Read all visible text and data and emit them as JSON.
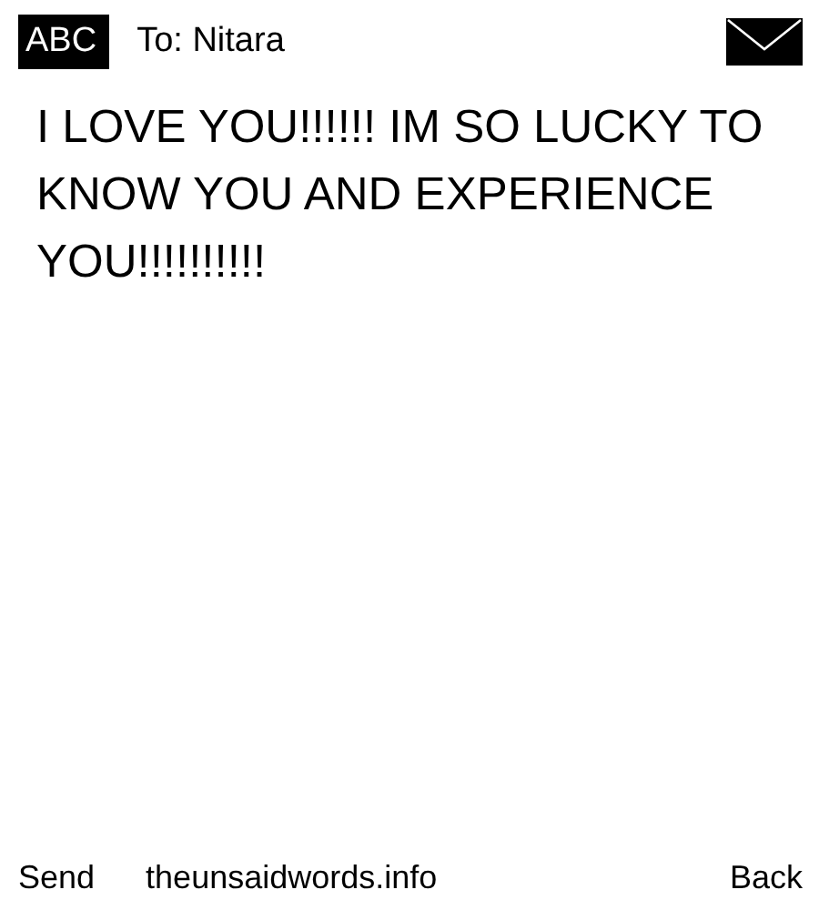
{
  "header": {
    "mode_badge": "ABC",
    "recipient": "To: Nitara"
  },
  "message": "I LOVE YOU!!!!!! IM SO LUCKY TO KNOW YOU AND EXPERIENCE YOU!!!!!!!!!!",
  "softkeys": {
    "left": "Send",
    "center": "theunsaidwords.info",
    "right": "Back"
  }
}
